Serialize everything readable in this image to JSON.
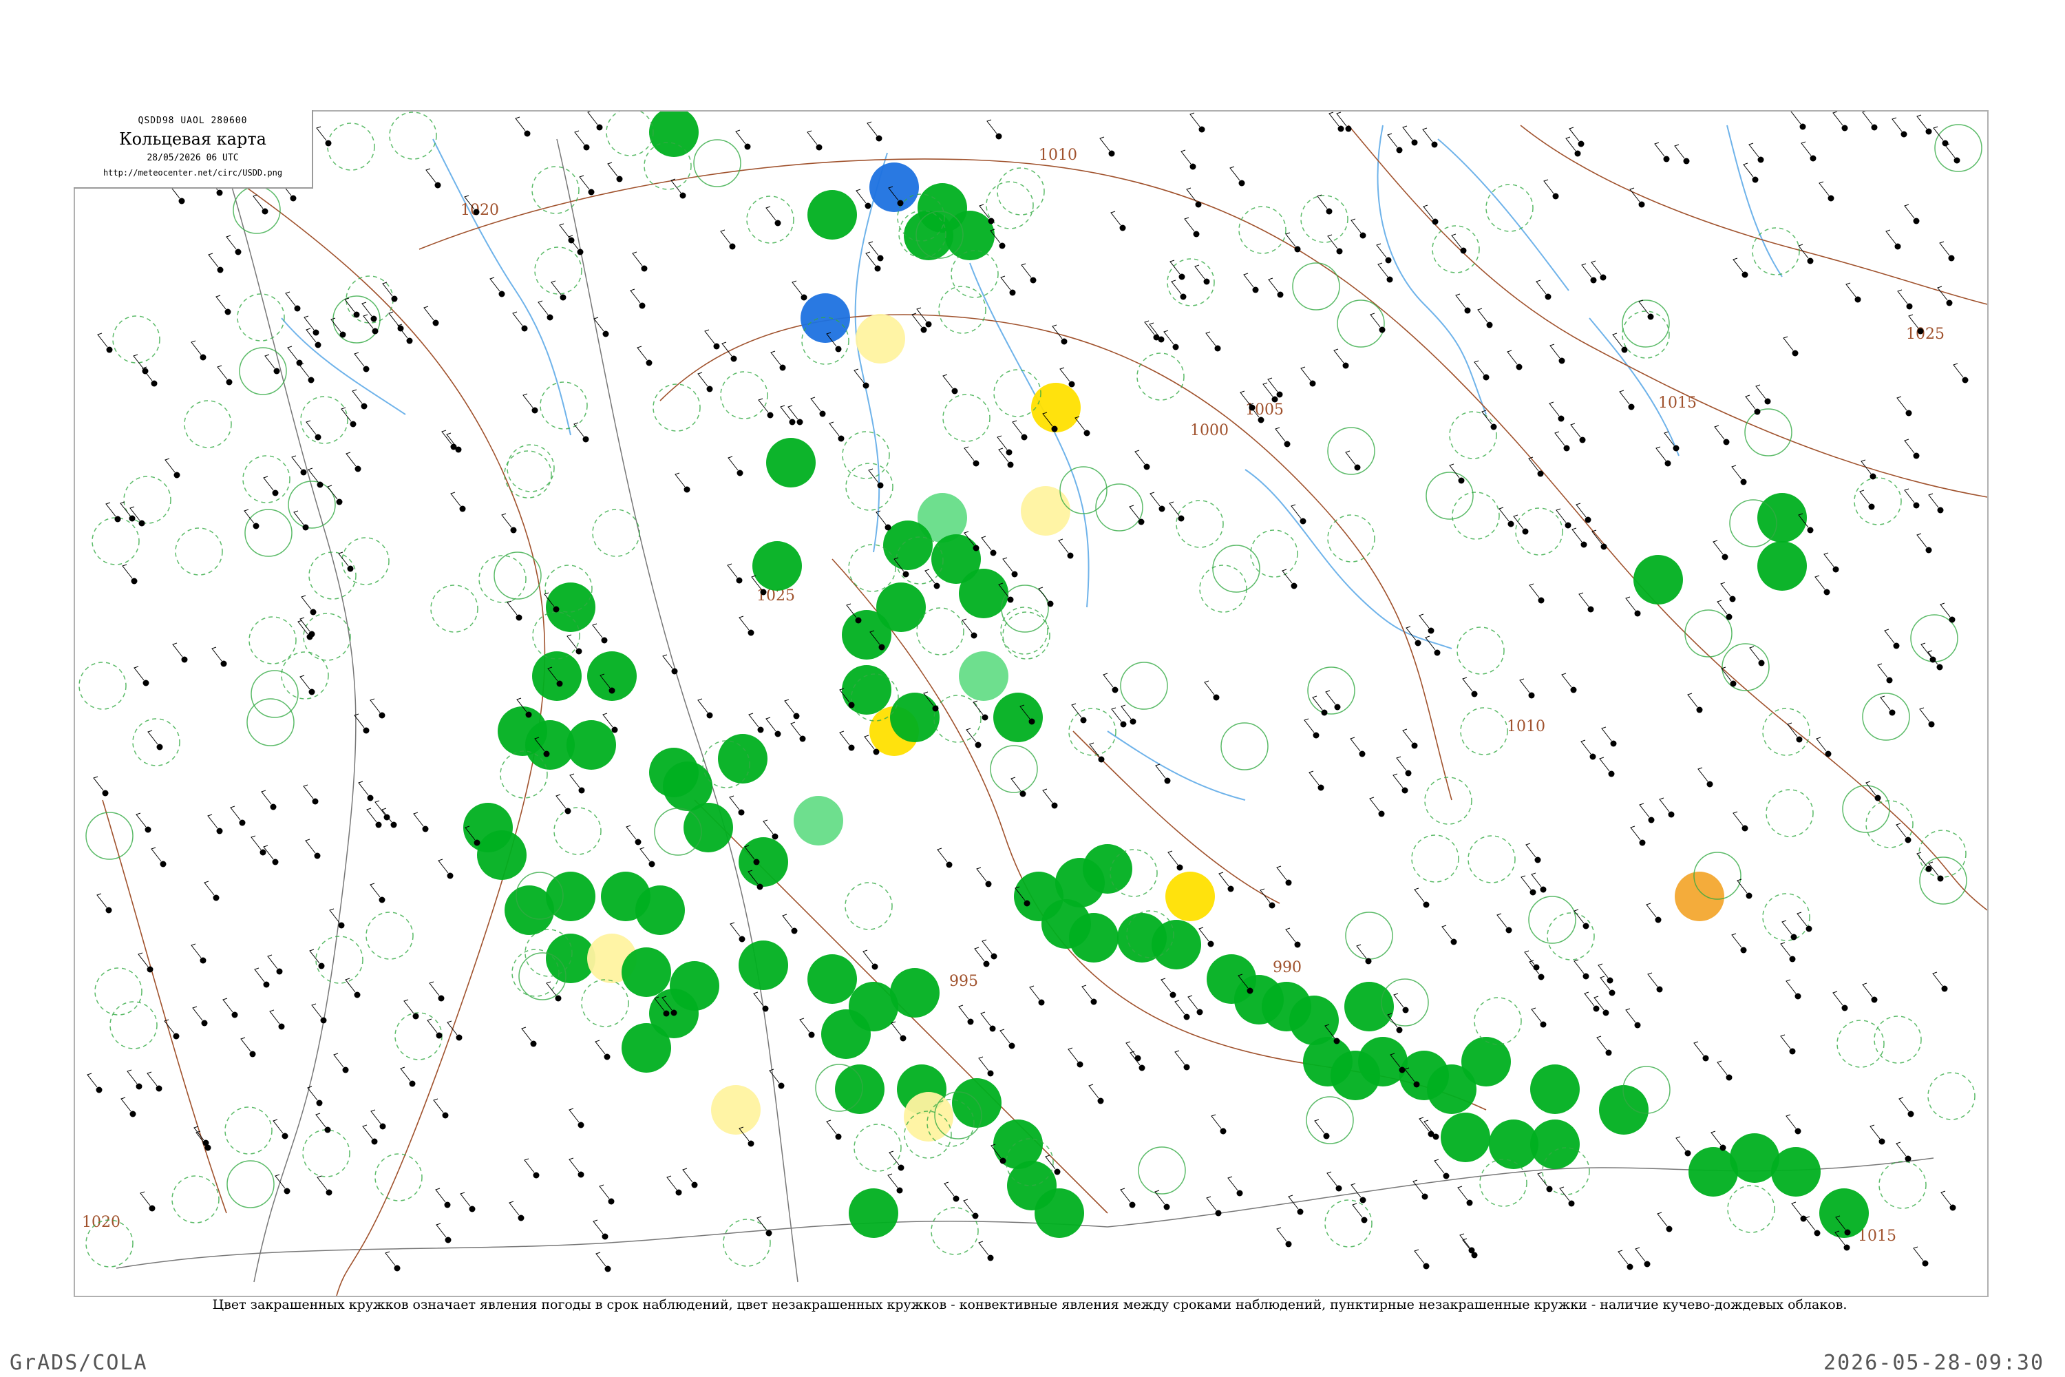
{
  "header": {
    "bulletin_code": "QSDD98  UAOL  280600",
    "title": "Кольцевая карта",
    "datetime": "28/05/2026 06 UTC",
    "url": "http://meteocenter.net/circ/USDD.png"
  },
  "caption": "Цвет закрашенных кружков означает явления погоды в срок наблюдений, цвет незакрашенных кружков - конвективные явления между сроками наблюдений, пунктирные незакрашенные кружки - наличие кучево-дождевых облаков.",
  "footer": {
    "left": "GrADS/COLA",
    "right": "2026-05-28-09:30"
  },
  "isobar_labels": [
    "1010",
    "1015",
    "1020",
    "1025",
    "1000",
    "1005",
    "995",
    "990"
  ],
  "colors": {
    "rain": "#00b020",
    "rain_light": "#66dd88",
    "thunder": "#ffe000",
    "drizzle": "#fff3a0",
    "snow": "#1e72e0",
    "haze": "#f3a830",
    "cb_ring": "#33aa44",
    "isobar": "#a0522d",
    "river": "#6fb3ea",
    "border": "#777777"
  },
  "station_symbols": {
    "filled_rain": "green-filled-circle",
    "filled_thunder": "yellow-filled-circle",
    "filled_snow": "blue-filled-circle",
    "filled_haze": "orange-filled-circle",
    "convective_between_obs": "solid-ring",
    "cumulonimbus": "dashed-ring"
  }
}
